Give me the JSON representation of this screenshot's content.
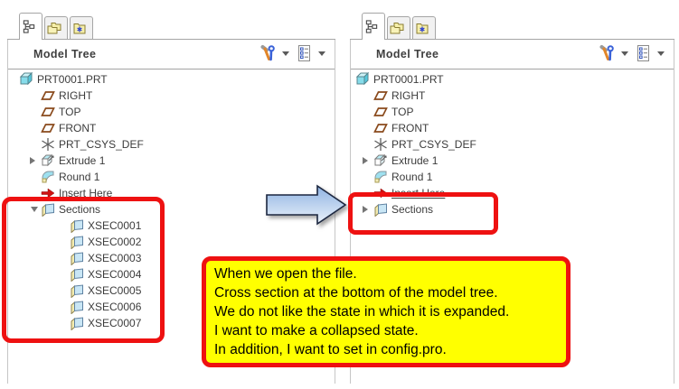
{
  "header": {
    "title": "Model Tree"
  },
  "tree": {
    "root": "PRT0001.PRT",
    "items": [
      {
        "label": "RIGHT",
        "icon": "datum-plane-icon"
      },
      {
        "label": "TOP",
        "icon": "datum-plane-icon"
      },
      {
        "label": "FRONT",
        "icon": "datum-plane-icon"
      },
      {
        "label": "PRT_CSYS_DEF",
        "icon": "csys-icon"
      },
      {
        "label": "Extrude 1",
        "icon": "extrude-icon",
        "state": "collapsed"
      },
      {
        "label": "Round 1",
        "icon": "round-icon"
      },
      {
        "label": "Insert Here",
        "icon": "insert-here-arrow-icon"
      },
      {
        "label": "Sections",
        "icon": "section-icon",
        "state_left": "expanded",
        "state_right": "collapsed"
      }
    ],
    "sections_children": [
      "XSEC0001",
      "XSEC0002",
      "XSEC0003",
      "XSEC0004",
      "XSEC0005",
      "XSEC0006",
      "XSEC0007"
    ]
  },
  "annotation": {
    "lines": [
      "When we open the file.",
      "Cross section at the bottom of the model tree.",
      "We do not like the state in which it is expanded.",
      "I want to make a collapsed state.",
      "In addition, I want to set in config.pro."
    ]
  },
  "icons": {
    "tab_1": "model-tree-tab-icon",
    "tab_2": "folders-tab-icon",
    "tab_3": "favorites-folder-tab-icon",
    "header_1": "tools-icon",
    "header_2": "tree-filters-list-icon",
    "expander_collapsed": "right-triangle",
    "expander_expanded": "down-triangle"
  },
  "colors": {
    "highlight_red": "#ee1111",
    "note_yellow": "#ffff00",
    "arrow_blue_top": "#8fb3e2",
    "arrow_blue_bottom": "#eaf2fb",
    "part_cyan": "#86dcea",
    "datum_brown": "#8a4a1c",
    "tree_text": "#3c3c3c"
  }
}
